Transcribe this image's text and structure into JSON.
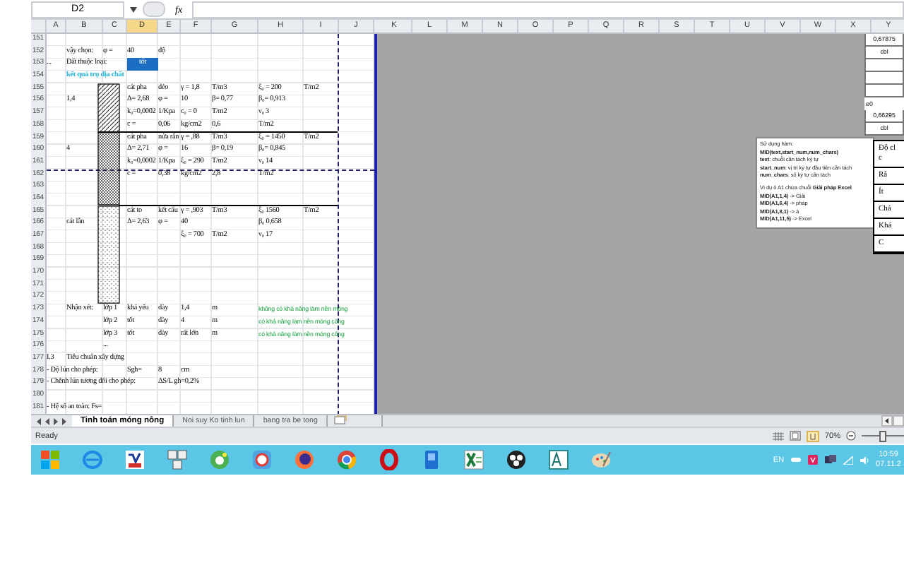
{
  "formula_bar": {
    "name_box": "D2",
    "function_label": "fx"
  },
  "columns": [
    "A",
    "B",
    "C",
    "D",
    "E",
    "F",
    "G",
    "H",
    "I",
    "J",
    "K",
    "L",
    "M",
    "N",
    "O",
    "P",
    "Q",
    "R",
    "S",
    "T",
    "U",
    "V",
    "W",
    "X",
    "Y"
  ],
  "rows": [
    {
      "number": "151",
      "cells": {}
    },
    {
      "number": "152",
      "cells": {
        "B": {
          "text": "vậy chọn:",
          "kind": "plain"
        },
        "C": {
          "text": "φ =",
          "kind": "plain"
        },
        "D": {
          "text": "40",
          "kind": "plain"
        },
        "E": {
          "text": "độ",
          "kind": "plain"
        }
      }
    },
    {
      "number": "153",
      "cells": {
        "A": {
          "text": "...",
          "kind": "plain"
        },
        "B": {
          "text": "Đất thuộc loại:",
          "kind": "plain"
        },
        "D": {
          "text": "tốt",
          "kind": "highlight"
        }
      }
    },
    {
      "number": "154",
      "cells": {
        "B": {
          "text": "kết quả trụ địa chất",
          "kind": "heading"
        }
      }
    },
    {
      "number": "155",
      "cells": {
        "D": {
          "text": "cát pha",
          "kind": "plain"
        },
        "E": {
          "text": "dẻo",
          "kind": "plain"
        },
        "F": {
          "text": "γ = 1,8",
          "kind": "plain"
        },
        "G": {
          "text": "T/m3",
          "kind": "plain"
        },
        "H": {
          "text": "ξ₀ = 200",
          "kind": "plain"
        },
        "I": {
          "text": "T/m2",
          "kind": "plain"
        }
      }
    },
    {
      "number": "156",
      "cells": {
        "B": {
          "text": "1,4",
          "kind": "plain"
        },
        "D": {
          "text": "Δ= 2,68",
          "kind": "plain"
        },
        "E": {
          "text": "φ =",
          "kind": "plain"
        },
        "F": {
          "text": "10",
          "kind": "plain"
        },
        "G": {
          "text": "β= 0,77",
          "kind": "plain"
        },
        "H": {
          "text": "β₀= 0,913",
          "kind": "plain"
        }
      }
    },
    {
      "number": "157",
      "cells": {
        "D": {
          "text": "k₀=0,0002",
          "kind": "plain"
        },
        "E": {
          "text": "1/Kpa",
          "kind": "plain"
        },
        "F": {
          "text": "c₀ = 0",
          "kind": "plain"
        },
        "G": {
          "text": "T/m2",
          "kind": "plain"
        },
        "H": {
          "text": "ν₀   3",
          "kind": "plain"
        }
      }
    },
    {
      "number": "158",
      "cells": {
        "D": {
          "text": "c =",
          "kind": "plain"
        },
        "E": {
          "text": "0,06",
          "kind": "plain"
        },
        "F": {
          "text": "kg/cm2",
          "kind": "plain"
        },
        "G": {
          "text": "0,6",
          "kind": "plain"
        },
        "H": {
          "text": "T/m2",
          "kind": "plain"
        }
      }
    },
    {
      "number": "159",
      "cells": {
        "D": {
          "text": "cát pha",
          "kind": "plain"
        },
        "E": {
          "text": "nửa rắn",
          "kind": "plain"
        },
        "F": {
          "text": "γ = ,88",
          "kind": "plain"
        },
        "G": {
          "text": "T/m3",
          "kind": "plain"
        },
        "H": {
          "text": "ξ₀ = 1450",
          "kind": "plain"
        },
        "I": {
          "text": "T/m2",
          "kind": "plain"
        }
      }
    },
    {
      "number": "160",
      "cells": {
        "B": {
          "text": "4",
          "kind": "plain"
        },
        "D": {
          "text": "Δ= 2,71",
          "kind": "plain"
        },
        "E": {
          "text": "φ =",
          "kind": "plain"
        },
        "F": {
          "text": "16",
          "kind": "plain"
        },
        "G": {
          "text": "β= 0,19",
          "kind": "plain"
        },
        "H": {
          "text": "β₀= 0,845",
          "kind": "plain"
        }
      }
    },
    {
      "number": "161",
      "cells": {
        "D": {
          "text": "k₀=0,0002",
          "kind": "plain"
        },
        "E": {
          "text": "1/Kpa",
          "kind": "plain"
        },
        "F": {
          "text": "ξ₀ = 290",
          "kind": "plain"
        },
        "G": {
          "text": "T/m2",
          "kind": "plain"
        },
        "H": {
          "text": "ν₀   14",
          "kind": "plain"
        }
      }
    },
    {
      "number": "162",
      "cells": {
        "D": {
          "text": "c =",
          "kind": "plain"
        },
        "E": {
          "text": "0,38",
          "kind": "plain"
        },
        "F": {
          "text": "kg/cm2",
          "kind": "plain"
        },
        "G": {
          "text": "2,8",
          "kind": "plain"
        },
        "H": {
          "text": "T/m2",
          "kind": "plain"
        }
      }
    },
    {
      "number": "163",
      "cells": {}
    },
    {
      "number": "164",
      "cells": {}
    },
    {
      "number": "165",
      "cells": {
        "D": {
          "text": "cát to",
          "kind": "plain"
        },
        "E": {
          "text": "kết cấu",
          "kind": "plain"
        },
        "F": {
          "text": "γ = ,903",
          "kind": "plain"
        },
        "G": {
          "text": "T/m3",
          "kind": "plain"
        },
        "H": {
          "text": "ξ₀  1560",
          "kind": "plain"
        },
        "I": {
          "text": "T/m2",
          "kind": "plain"
        }
      }
    },
    {
      "number": "166",
      "cells": {
        "B": {
          "text": "cát lẫn",
          "kind": "plain"
        },
        "D": {
          "text": "Δ= 2,63",
          "kind": "plain"
        },
        "E": {
          "text": "φ =",
          "kind": "plain"
        },
        "F": {
          "text": "40",
          "kind": "plain"
        },
        "H": {
          "text": "β₀  0,658",
          "kind": "plain"
        }
      }
    },
    {
      "number": "167",
      "cells": {
        "F": {
          "text": "ξ₀ = 700",
          "kind": "plain"
        },
        "G": {
          "text": "T/m2",
          "kind": "plain"
        },
        "H": {
          "text": "ν₀  17",
          "kind": "plain"
        }
      }
    },
    {
      "number": "168",
      "cells": {}
    },
    {
      "number": "169",
      "cells": {}
    },
    {
      "number": "170",
      "cells": {}
    },
    {
      "number": "171",
      "cells": {}
    },
    {
      "number": "172",
      "cells": {}
    },
    {
      "number": "173",
      "cells": {
        "B": {
          "text": "Nhận xét:",
          "kind": "plain"
        },
        "C": {
          "text": "lớp 1",
          "kind": "plain"
        },
        "D": {
          "text": "khá yếu",
          "kind": "plain"
        },
        "E": {
          "text": "dày",
          "kind": "plain"
        },
        "F": {
          "text": "1,4",
          "kind": "plain"
        },
        "G": {
          "text": "m",
          "kind": "plain"
        },
        "H": {
          "text": "không có khả năng làm nền móng",
          "kind": "note"
        }
      }
    },
    {
      "number": "174",
      "cells": {
        "C": {
          "text": "lớp 2",
          "kind": "plain"
        },
        "D": {
          "text": "tốt",
          "kind": "plain"
        },
        "E": {
          "text": "dày",
          "kind": "plain"
        },
        "F": {
          "text": "4",
          "kind": "plain"
        },
        "G": {
          "text": "m",
          "kind": "plain"
        },
        "H": {
          "text": "có khả năng làm nền móng công",
          "kind": "note"
        }
      }
    },
    {
      "number": "175",
      "cells": {
        "C": {
          "text": "lớp 3",
          "kind": "plain"
        },
        "D": {
          "text": "tốt",
          "kind": "plain"
        },
        "E": {
          "text": "dày",
          "kind": "plain"
        },
        "F": {
          "text": "rất lớn",
          "kind": "plain"
        },
        "G": {
          "text": "m",
          "kind": "plain"
        },
        "H": {
          "text": "có khả năng làm nền móng công",
          "kind": "note"
        }
      }
    },
    {
      "number": "176",
      "cells": {
        "C": {
          "text": "...",
          "kind": "plain"
        }
      }
    },
    {
      "number": "177",
      "cells": {
        "A": {
          "text": "I.3",
          "kind": "plain"
        },
        "B": {
          "text": "Tiêu chuẩn xây dựng",
          "kind": "plain"
        }
      }
    },
    {
      "number": "178",
      "cells": {
        "A": {
          "text": "- Độ lún cho phép:",
          "kind": "plain"
        },
        "D": {
          "text": "Sgh=",
          "kind": "plain"
        },
        "E": {
          "text": "8",
          "kind": "plain"
        },
        "F": {
          "text": "cm",
          "kind": "plain"
        }
      }
    },
    {
      "number": "179",
      "cells": {
        "A": {
          "text": "- Chênh lún tương đối cho phép:",
          "kind": "plain"
        },
        "E": {
          "text": "ΔS/L gh=0,2%",
          "kind": "plain"
        }
      }
    },
    {
      "number": "180",
      "cells": {}
    },
    {
      "number": "181",
      "cells": {
        "A": {
          "text": "- Hệ số an toàn: Fs=",
          "kind": "plain"
        }
      }
    }
  ],
  "side_cells": {
    "block_1": [
      "0,67875",
      "cbl"
    ],
    "label": "e0",
    "block_2": [
      "0,66295",
      "cbl"
    ]
  },
  "comment": {
    "paragraphs": [
      [
        {
          "text": "Sử dụng hàm:",
          "bold": false
        },
        {
          "text": "MID(text,start_num,num_chars)",
          "bold": true
        },
        {
          "text": "**text**: chuỗi cần tách ký tự",
          "bold": false
        },
        {
          "text": "**start_num**: vị trí ký tự đầu tiên cần tách",
          "bold": false
        },
        {
          "text": "**num_chars**: số ký tự cần tách",
          "bold": false
        }
      ],
      [
        {
          "text": "Ví dụ ô A1 chứa chuỗi **Giải pháp Excel**",
          "bold": false
        },
        {
          "text": "**MID(A1,1,4)** -> Giải",
          "bold": false
        },
        {
          "text": "**MID(A1,6,4)** -> pháp",
          "bold": false
        },
        {
          "text": "**MID(A1,8,1)** -> á",
          "bold": false
        },
        {
          "text": "**MID(A1,11,5)** -> Excel",
          "bold": false
        }
      ]
    ]
  },
  "side_table": [
    {
      "lines": [
        "Độ cl",
        "c"
      ]
    },
    {
      "lines": [
        "Rắ"
      ]
    },
    {
      "lines": [
        "Ít"
      ]
    },
    {
      "lines": [
        "Chả"
      ]
    },
    {
      "lines": [
        "Khá"
      ]
    },
    {
      "lines": [
        "C"
      ]
    }
  ],
  "sheet_tabs": [
    {
      "label": "Tinh toán móng nông",
      "selected": true
    },
    {
      "label": "Noi suy Ko tinh lun",
      "selected": false
    },
    {
      "label": "bang tra be tong",
      "selected": false
    }
  ],
  "status_bar": {
    "status": "Ready",
    "zoom": {
      "reading": "70%",
      "level": 0.5
    }
  },
  "taskbar": {
    "language": "EN",
    "time": "10:59",
    "date": "07.11.2"
  }
}
